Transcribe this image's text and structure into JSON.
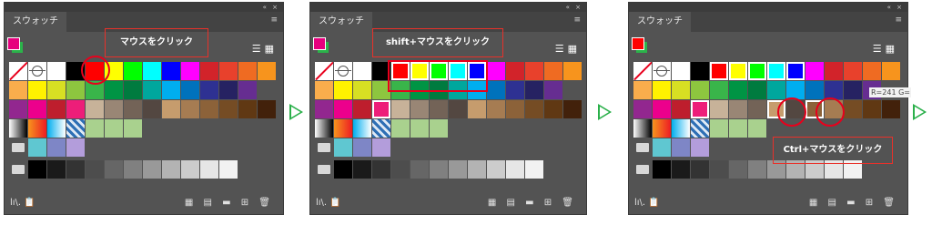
{
  "panels": [
    {
      "tab": "スウォッチ",
      "window_controls": "« ×",
      "menu_icon": "≡",
      "callout": "マウスをクリック",
      "bottom_left": "lı\\. 📋",
      "bottom_right": "▦ ▤ ▬ ⊞ 🗑"
    },
    {
      "tab": "スウォッチ",
      "window_controls": "« ×",
      "menu_icon": "≡",
      "callout": "shift+マウスをクリック",
      "bottom_left": "lı\\. 📋",
      "bottom_right": "▦ ▤ ▬ ⊞ 🗑"
    },
    {
      "tab": "スウォッチ",
      "window_controls": "« ×",
      "menu_icon": "≡",
      "callout": "Ctrl+マウスをクリック",
      "tooltip": "R=241 G=",
      "bottom_left": "lı\\. 📋",
      "bottom_right": "▦ ▤ ▬ ⊞ 🗑"
    }
  ],
  "icons": {
    "list_view": "list-view-icon",
    "thumb_view": "thumbnail-view-icon",
    "arrow": "next-step-arrow"
  },
  "colors": {
    "accent_red": "#e8001c",
    "arrow_green": "#2ab04a",
    "row1": [
      "#ff0000",
      "#ffff00",
      "#00ff00",
      "#00ffff",
      "#0000ff",
      "#ff00ff",
      "#d2232a",
      "#e8412c",
      "#ef6b22",
      "#f7941d"
    ],
    "row2": [
      "#f9ad4c",
      "#fff200",
      "#d7df23",
      "#8dc63f",
      "#39b54a",
      "#009444",
      "#007b3f",
      "#00a79d",
      "#00aeef",
      "#0072bc",
      "#2e3192",
      "#262262",
      "#662d91"
    ],
    "row3": [
      "#92278f",
      "#ec008c",
      "#be1e2d",
      "#ed1e79",
      "#c7b299",
      "#998675",
      "#736357",
      "#534741",
      "#c69c6d",
      "#a67c52",
      "#8c6239",
      "#754c24",
      "#603813",
      "#42210b"
    ],
    "row4": [
      "#f7f7f7",
      "#ed7d31",
      "#00a2e8",
      "#5b9bd5",
      "#a9d18e",
      "#a9d18e",
      "#a9d18e"
    ],
    "row5": [
      "#5fc7d1",
      "#7e86c6",
      "#b39ddb"
    ],
    "row6": [
      "#000000",
      "#1a1a1a",
      "#333333",
      "#4d4d4d",
      "#666666",
      "#808080",
      "#999999",
      "#b3b3b3",
      "#cccccc",
      "#e6e6e6",
      "#f2f2f2"
    ]
  }
}
